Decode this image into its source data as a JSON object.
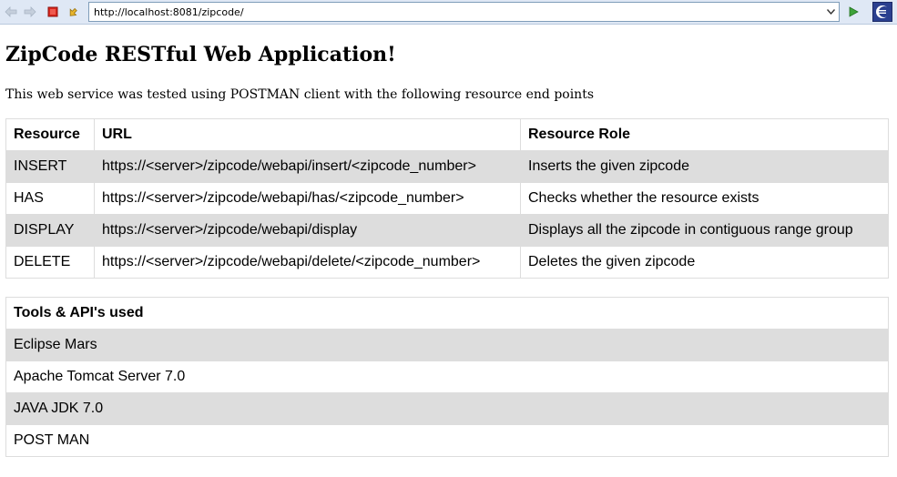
{
  "browser": {
    "url": "http://localhost:8081/zipcode/",
    "icons": {
      "back": "back-arrow-icon",
      "forward": "forward-arrow-icon",
      "stop": "stop-icon",
      "refresh": "refresh-icon",
      "go": "go-play-icon",
      "eclipse": "eclipse-logo-icon"
    }
  },
  "page": {
    "title": "ZipCode RESTful Web Application!",
    "intro": "This web service was tested using POSTMAN client with the following resource end points"
  },
  "resources_table": {
    "headers": [
      "Resource",
      "URL",
      "Resource Role"
    ],
    "rows": [
      [
        "INSERT",
        "https://<server>/zipcode/webapi/insert/<zipcode_number>",
        "Inserts the given zipcode"
      ],
      [
        "HAS",
        "https://<server>/zipcode/webapi/has/<zipcode_number>",
        "Checks whether the resource exists"
      ],
      [
        "DISPLAY",
        "https://<server>/zipcode/webapi/display",
        "Displays all the zipcode in contiguous range group"
      ],
      [
        "DELETE",
        "https://<server>/zipcode/webapi/delete/<zipcode_number>",
        "Deletes the given zipcode"
      ]
    ]
  },
  "tools_table": {
    "header": "Tools & API's used",
    "rows": [
      "Eclipse Mars",
      "Apache Tomcat Server 7.0",
      "JAVA JDK 7.0",
      "POST MAN"
    ]
  },
  "colors": {
    "toolbar_bg": "#dfe8f5",
    "row_shade": "#dddddd",
    "border": "#dddddd"
  }
}
